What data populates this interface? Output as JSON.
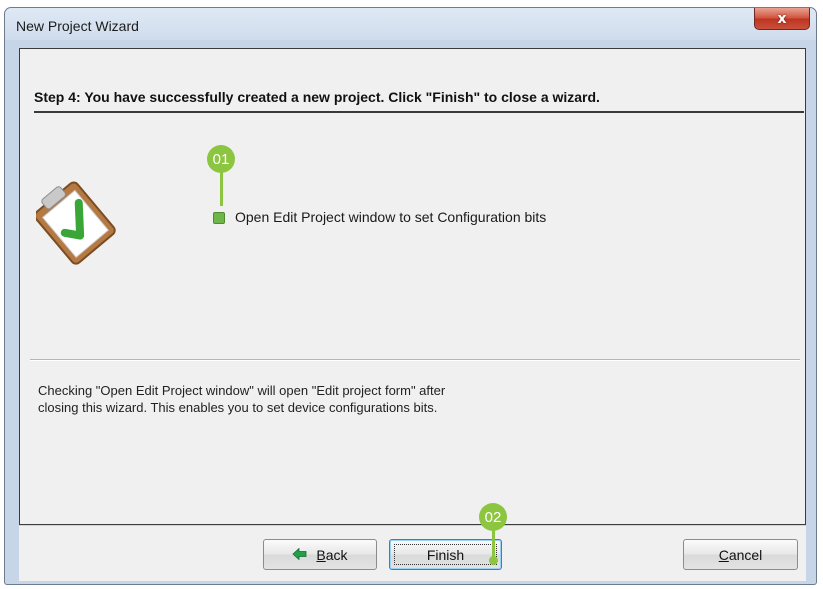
{
  "window": {
    "title": "New Project Wizard",
    "close_glyph": "x"
  },
  "step": {
    "title": "Step 4: You have successfully created a new project.  Click \"Finish\" to close a wizard."
  },
  "option": {
    "label": "Open Edit Project window to set Configuration bits",
    "checked": true
  },
  "help": {
    "line1": "Checking \"Open Edit Project window\" will open \"Edit project form\" after",
    "line2": "closing this wizard. This enables you to set device configurations bits."
  },
  "buttons": {
    "back_mnemonic": "B",
    "back_rest": "ack",
    "finish": "Finish",
    "cancel_mnemonic": "C",
    "cancel_rest": "ancel"
  },
  "callouts": {
    "first": "01",
    "second": "02"
  },
  "colors": {
    "accent": "#8cc540",
    "checkmark": "#3aa638",
    "close": "#c9503b"
  },
  "icons": [
    "clipboard-check-icon",
    "back-arrow-icon",
    "close-icon"
  ]
}
